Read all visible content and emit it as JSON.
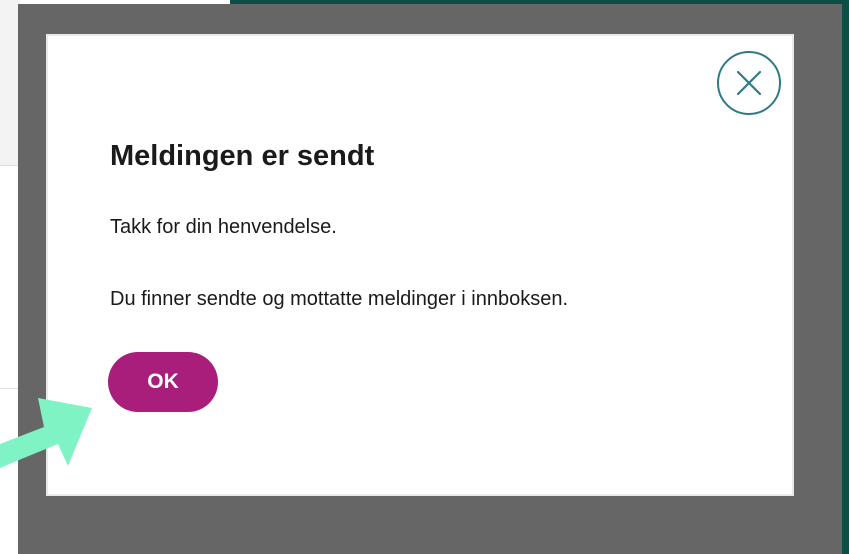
{
  "modal": {
    "title": "Meldingen er sendt",
    "message_1": "Takk for din henvendelse.",
    "message_2": "Du finner sendte og mottatte meldinger i innboksen.",
    "ok_label": "OK",
    "close_icon": "close-icon"
  },
  "colors": {
    "overlay": "#666666",
    "ok_button": "#a81e7a",
    "close_ring": "#2f7b84",
    "annotation_arrow": "#7ff3c3",
    "page_edge": "#0e4f45"
  }
}
